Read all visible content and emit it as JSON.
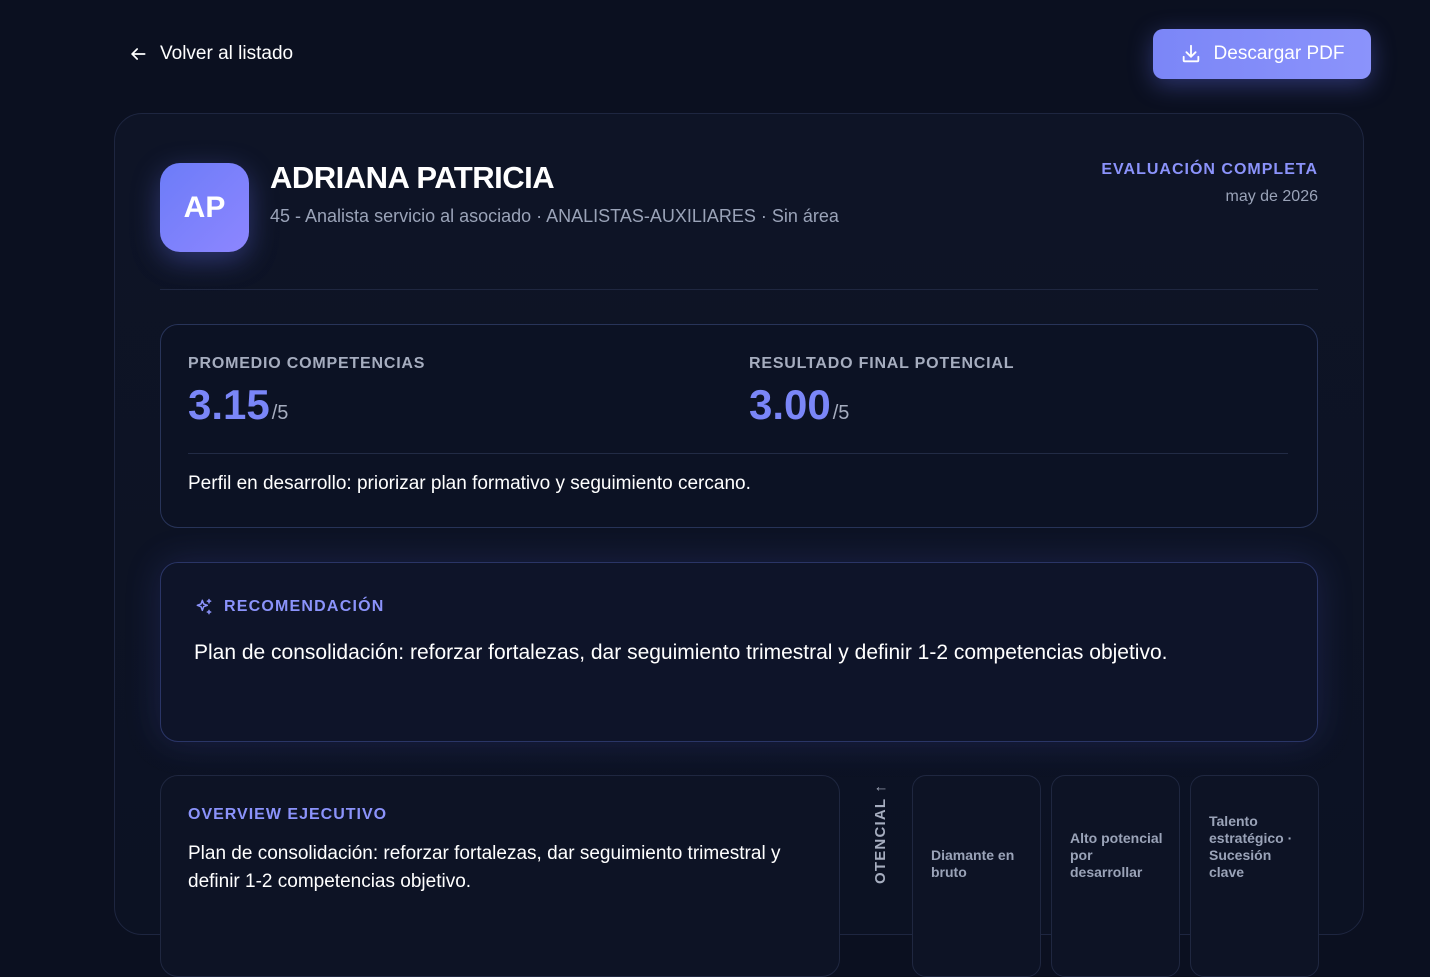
{
  "nav": {
    "back_label": "Volver al listado",
    "download_label": "Descargar PDF"
  },
  "profile": {
    "initials": "AP",
    "name": "ADRIANA PATRICIA",
    "subtitle": "45 - Analista servicio al asociado · ANALISTAS-AUXILIARES · Sin área",
    "status_label": "EVALUACIÓN COMPLETA",
    "status_date": "may de 2026"
  },
  "scores": {
    "competencias_label": "PROMEDIO COMPETENCIAS",
    "competencias_value": "3.15",
    "competencias_max": "/5",
    "potencial_label": "RESULTADO FINAL POTENCIAL",
    "potencial_value": "3.00",
    "potencial_max": "/5",
    "note": "Perfil en desarrollo: priorizar plan formativo y seguimiento cercano."
  },
  "recommendation": {
    "title": "RECOMENDACIÓN",
    "text": "Plan de consolidación: reforzar fortalezas, dar seguimiento trimestral y definir 1-2 competencias objetivo."
  },
  "overview": {
    "title": "OVERVIEW EJECUTIVO",
    "text": "Plan de consolidación: reforzar fortalezas, dar seguimiento trimestral y definir 1-2 competencias objetivo."
  },
  "matrix": {
    "axis_label": "OTENCIAL ↑",
    "cells": [
      "Diamante en bruto",
      "Alto potencial por desarrollar",
      "Talento estratégico · Sucesión clave"
    ]
  },
  "colors": {
    "accent": "#7a86f8",
    "background": "#0b1020"
  }
}
